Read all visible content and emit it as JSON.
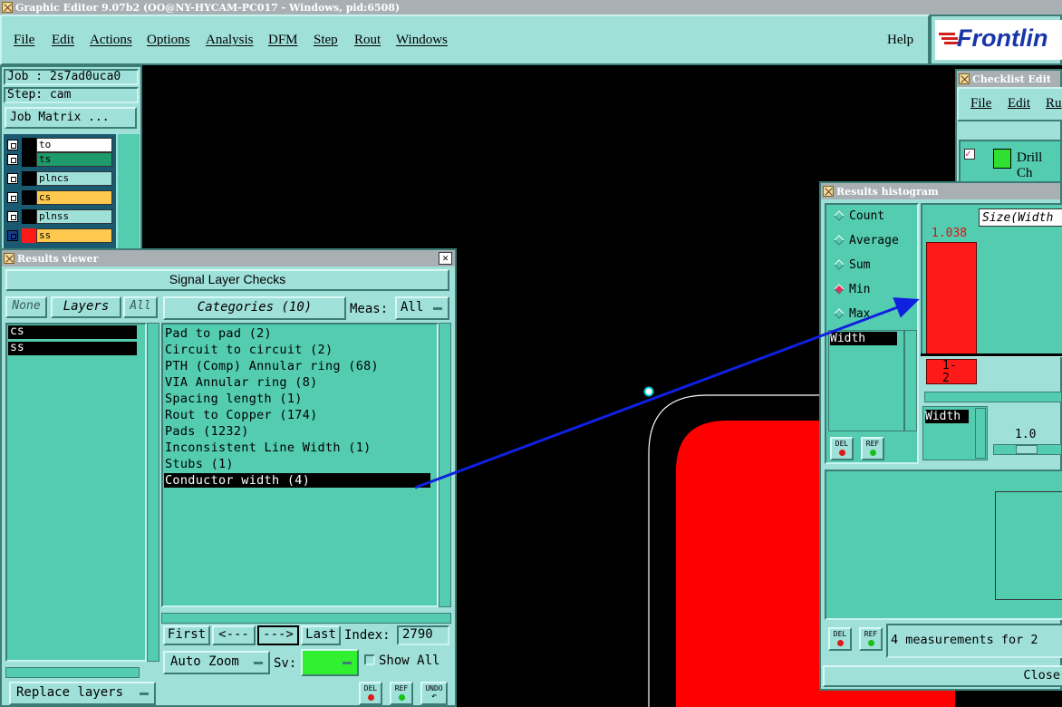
{
  "window_title": "Graphic Editor 9.07b2 (OO@NY-HYCAM-PC017 - Windows, pid:6508)",
  "menu": [
    "File",
    "Edit",
    "Actions",
    "Options",
    "Analysis",
    "DFM",
    "Step",
    "Rout",
    "Windows"
  ],
  "help": "Help",
  "brand": "Frontlin",
  "job": {
    "job": "Job : 2s7ad0uca0",
    "step": "Step: cam",
    "matrix": "Job Matrix ..."
  },
  "layers": [
    {
      "name": "to",
      "color": "#ffffff"
    },
    {
      "name": "ts",
      "color": "#1f9a6a"
    },
    {
      "name": "plncs",
      "color": "#9fe0d9"
    },
    {
      "name": "cs",
      "color": "#ffc94f"
    },
    {
      "name": "plnss",
      "color": "#9fe0d9"
    },
    {
      "name": "ss",
      "color": "#ffc94f"
    }
  ],
  "results_viewer": {
    "title": "Results viewer",
    "header": "Signal Layer Checks",
    "none": "None",
    "layers": "Layers",
    "all": "All",
    "categories_btn": "Categories (10)",
    "meas_label": "Meas:",
    "meas_value": "All",
    "layer_list": [
      "cs",
      "ss"
    ],
    "categories": [
      "Pad to pad (2)",
      "Circuit to circuit (2)",
      "PTH (Comp) Annular ring (68)",
      "VIA Annular ring (8)",
      "Spacing length (1)",
      "Rout to Copper (174)",
      "Pads (1232)",
      "Inconsistent Line Width (1)",
      "Stubs (1)",
      "Conductor width (4)"
    ],
    "first": "First",
    "prev": "<---",
    "next": "--->",
    "last": "Last",
    "index_label": "Index:",
    "index_value": "2790",
    "auto_zoom": "Auto Zoom",
    "sv_label": "Sv:",
    "show_all": "Show All",
    "replace_layers": "Replace layers",
    "del": "DEL",
    "ref": "REF",
    "undo": "UNDO"
  },
  "checklist": {
    "title": "Checklist Edit",
    "menu": [
      "File",
      "Edit",
      "Ru"
    ],
    "item": "Drill Ch"
  },
  "histogram": {
    "title": "Results histogram",
    "options": [
      "Count",
      "Average",
      "Sum",
      "Min",
      "Max"
    ],
    "selected": "Min",
    "field": "Width",
    "axis_label": "Size(Width",
    "bar_value": "1.038",
    "bar_label": "1-\n2",
    "width_label": "Width",
    "slider_value": "1.0",
    "del": "DEL",
    "ref": "REF",
    "status": "4 measurements for 2",
    "close": "Close"
  }
}
